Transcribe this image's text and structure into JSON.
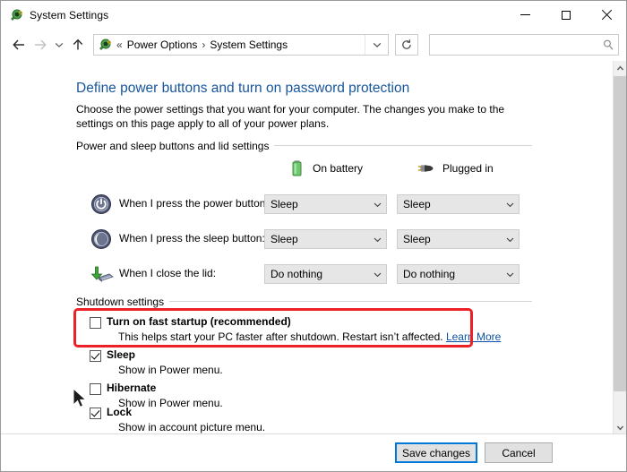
{
  "window": {
    "title": "System Settings",
    "icon": "power-plug-icon",
    "controls": {
      "minimize": "minimize-button",
      "maximize": "maximize-button",
      "close": "close-button"
    }
  },
  "addressbar": {
    "back": "back-arrow-icon",
    "forward": "forward-arrow-icon",
    "history": "recent-locations-icon",
    "up": "up-arrow-icon",
    "icon": "power-plug-icon",
    "overflow": "«",
    "separator": "›",
    "crumbs": [
      "Power Options",
      "System Settings"
    ],
    "dropdown": "chevron-down-icon",
    "refresh": "refresh-icon",
    "search": {
      "value": "",
      "placeholder": "",
      "icon": "search-icon"
    }
  },
  "page": {
    "heading": "Define power buttons and turn on password protection",
    "description": "Choose the power settings that you want for your computer. The changes you make to the settings on this page apply to all of your power plans."
  },
  "groups": {
    "power_sleep": {
      "label": "Power and sleep buttons and lid settings",
      "columns": [
        {
          "label": "On battery",
          "icon": "battery-icon"
        },
        {
          "label": "Plugged in",
          "icon": "power-plug-icon"
        }
      ],
      "rows": [
        {
          "icon": "power-button-icon",
          "label": "When I press the power button:",
          "on_battery": "Sleep",
          "plugged_in": "Sleep"
        },
        {
          "icon": "sleep-button-icon",
          "label": "When I press the sleep button:",
          "on_battery": "Sleep",
          "plugged_in": "Sleep"
        },
        {
          "icon": "laptop-lid-icon",
          "label": "When I close the lid:",
          "on_battery": "Do nothing",
          "plugged_in": "Do nothing"
        }
      ]
    },
    "shutdown": {
      "label": "Shutdown settings",
      "items": [
        {
          "title": "Turn on fast startup (recommended)",
          "subtitle_before": "This helps start your PC faster after shutdown. Restart isn’t affected. ",
          "link": "Learn More",
          "checked": false,
          "highlighted": true
        },
        {
          "title": "Sleep",
          "subtitle_before": "Show in Power menu.",
          "link": "",
          "checked": true,
          "highlighted": false
        },
        {
          "title": "Hibernate",
          "subtitle_before": "Show in Power menu.",
          "link": "",
          "checked": false,
          "highlighted": false
        },
        {
          "title": "Lock",
          "subtitle_before": "Show in account picture menu.",
          "link": "",
          "checked": true,
          "highlighted": false
        }
      ]
    }
  },
  "footer": {
    "save_label": "Save changes",
    "cancel_label": "Cancel"
  },
  "scrollbar": {
    "up": "scroll-up-arrow-icon",
    "down": "scroll-down-arrow-icon"
  },
  "colors": {
    "heading": "#17559d",
    "link": "#0b52a8",
    "highlight": "#ec2127",
    "accent": "#0078d7"
  }
}
